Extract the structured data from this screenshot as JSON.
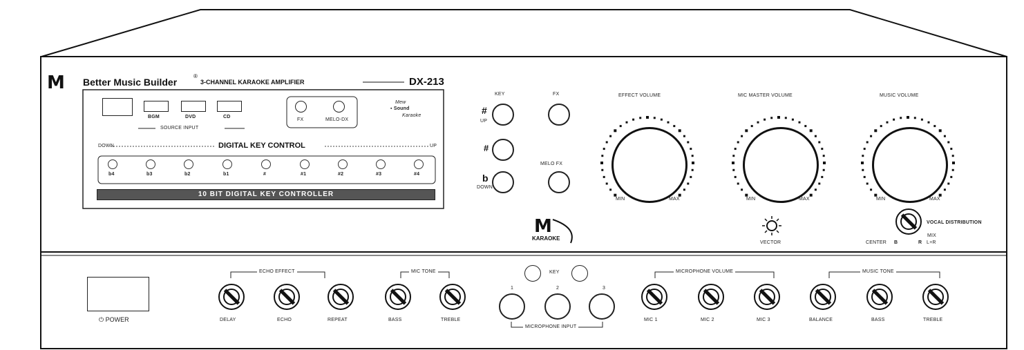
{
  "brand": {
    "logo": "M",
    "name": "Better Music Builder",
    "registered": "®",
    "subtitle": "3-CHANNEL KARAOKE AMPLIFIER",
    "model": "DX-213"
  },
  "source_input": {
    "buttons": [
      "BGM",
      "DVD",
      "CD"
    ],
    "label": "SOURCE INPUT"
  },
  "fx_buttons": [
    "FX",
    "MELO-DX"
  ],
  "mode_indicator": {
    "line1": "Mew",
    "line2": "Sound",
    "line3": "Karaoke"
  },
  "digital_key": {
    "left": "DOWN",
    "title": "DIGITAL KEY CONTROL",
    "right": "UP",
    "keys": [
      "b4",
      "b3",
      "b2",
      "b1",
      "#",
      "#1",
      "#2",
      "#3",
      "#4"
    ],
    "bar": "10 BIT DIGITAL KEY CONTROLLER"
  },
  "key_buttons": {
    "header": "KEY",
    "up_symbol": "#",
    "up_label": "UP",
    "mid_symbol": "#",
    "down_symbol": "b",
    "down_label": "DOWN"
  },
  "fx_column": {
    "top": "FX",
    "bottom": "MELO FX"
  },
  "volumes": [
    {
      "label": "EFFECT VOLUME",
      "min": "MIN",
      "max": "MAX"
    },
    {
      "label": "MIC MASTER VOLUME",
      "min": "MIN",
      "max": "MAX"
    },
    {
      "label": "MUSIC VOLUME",
      "min": "MIN",
      "max": "MAX"
    }
  ],
  "bottom_logo": {
    "mark": "M",
    "text": "KARAOKE"
  },
  "vector": {
    "label": "VECTOR"
  },
  "vocal": {
    "title": "VOCAL DISTRIBUTION",
    "center": "CENTER",
    "left": "B",
    "mix": "MIX",
    "r": "R",
    "right": "L+R"
  },
  "power": {
    "icon": "⏻",
    "label": "POWER"
  },
  "echo_effect": {
    "group": "ECHO EFFECT",
    "knobs": [
      "DELAY",
      "ECHO",
      "REPEAT"
    ]
  },
  "mic_tone": {
    "group": "MIC TONE",
    "knobs": [
      "BASS",
      "TREBLE"
    ]
  },
  "mic_key": {
    "label": "KEY",
    "jacks": [
      "1",
      "2",
      "3"
    ],
    "group": "MICROPHONE INPUT"
  },
  "mic_volume": {
    "group": "MICROPHONE VOLUME",
    "knobs": [
      "MIC 1",
      "MIC 2",
      "MIC 3"
    ]
  },
  "music_tone": {
    "group": "MUSIC TONE",
    "knobs": [
      "BALANCE",
      "BASS",
      "TREBLE"
    ]
  },
  "colors": {
    "line": "#111111",
    "bar": "#555555",
    "bar_text": "#ffffff"
  }
}
